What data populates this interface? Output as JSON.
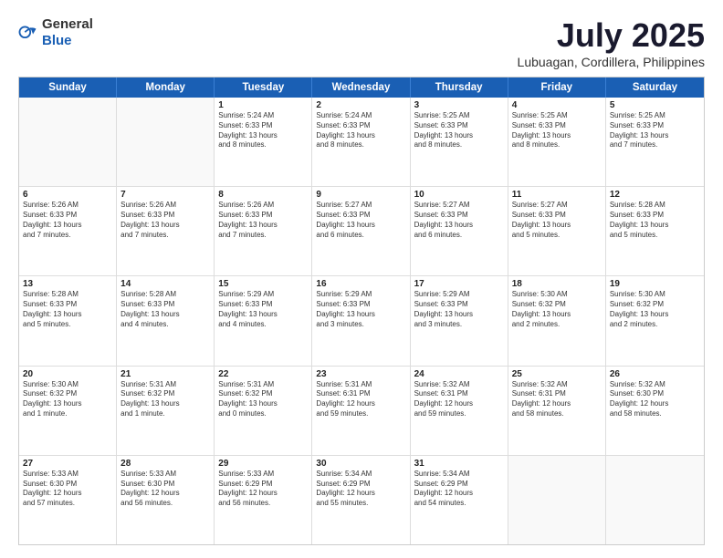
{
  "header": {
    "logo_general": "General",
    "logo_blue": "Blue",
    "month": "July 2025",
    "location": "Lubuagan, Cordillera, Philippines"
  },
  "weekdays": [
    "Sunday",
    "Monday",
    "Tuesday",
    "Wednesday",
    "Thursday",
    "Friday",
    "Saturday"
  ],
  "rows": [
    [
      {
        "day": "",
        "text": "",
        "empty": true
      },
      {
        "day": "",
        "text": "",
        "empty": true
      },
      {
        "day": "1",
        "text": "Sunrise: 5:24 AM\nSunset: 6:33 PM\nDaylight: 13 hours\nand 8 minutes."
      },
      {
        "day": "2",
        "text": "Sunrise: 5:24 AM\nSunset: 6:33 PM\nDaylight: 13 hours\nand 8 minutes."
      },
      {
        "day": "3",
        "text": "Sunrise: 5:25 AM\nSunset: 6:33 PM\nDaylight: 13 hours\nand 8 minutes."
      },
      {
        "day": "4",
        "text": "Sunrise: 5:25 AM\nSunset: 6:33 PM\nDaylight: 13 hours\nand 8 minutes."
      },
      {
        "day": "5",
        "text": "Sunrise: 5:25 AM\nSunset: 6:33 PM\nDaylight: 13 hours\nand 7 minutes."
      }
    ],
    [
      {
        "day": "6",
        "text": "Sunrise: 5:26 AM\nSunset: 6:33 PM\nDaylight: 13 hours\nand 7 minutes."
      },
      {
        "day": "7",
        "text": "Sunrise: 5:26 AM\nSunset: 6:33 PM\nDaylight: 13 hours\nand 7 minutes."
      },
      {
        "day": "8",
        "text": "Sunrise: 5:26 AM\nSunset: 6:33 PM\nDaylight: 13 hours\nand 7 minutes."
      },
      {
        "day": "9",
        "text": "Sunrise: 5:27 AM\nSunset: 6:33 PM\nDaylight: 13 hours\nand 6 minutes."
      },
      {
        "day": "10",
        "text": "Sunrise: 5:27 AM\nSunset: 6:33 PM\nDaylight: 13 hours\nand 6 minutes."
      },
      {
        "day": "11",
        "text": "Sunrise: 5:27 AM\nSunset: 6:33 PM\nDaylight: 13 hours\nand 5 minutes."
      },
      {
        "day": "12",
        "text": "Sunrise: 5:28 AM\nSunset: 6:33 PM\nDaylight: 13 hours\nand 5 minutes."
      }
    ],
    [
      {
        "day": "13",
        "text": "Sunrise: 5:28 AM\nSunset: 6:33 PM\nDaylight: 13 hours\nand 5 minutes."
      },
      {
        "day": "14",
        "text": "Sunrise: 5:28 AM\nSunset: 6:33 PM\nDaylight: 13 hours\nand 4 minutes."
      },
      {
        "day": "15",
        "text": "Sunrise: 5:29 AM\nSunset: 6:33 PM\nDaylight: 13 hours\nand 4 minutes."
      },
      {
        "day": "16",
        "text": "Sunrise: 5:29 AM\nSunset: 6:33 PM\nDaylight: 13 hours\nand 3 minutes."
      },
      {
        "day": "17",
        "text": "Sunrise: 5:29 AM\nSunset: 6:33 PM\nDaylight: 13 hours\nand 3 minutes."
      },
      {
        "day": "18",
        "text": "Sunrise: 5:30 AM\nSunset: 6:32 PM\nDaylight: 13 hours\nand 2 minutes."
      },
      {
        "day": "19",
        "text": "Sunrise: 5:30 AM\nSunset: 6:32 PM\nDaylight: 13 hours\nand 2 minutes."
      }
    ],
    [
      {
        "day": "20",
        "text": "Sunrise: 5:30 AM\nSunset: 6:32 PM\nDaylight: 13 hours\nand 1 minute."
      },
      {
        "day": "21",
        "text": "Sunrise: 5:31 AM\nSunset: 6:32 PM\nDaylight: 13 hours\nand 1 minute."
      },
      {
        "day": "22",
        "text": "Sunrise: 5:31 AM\nSunset: 6:32 PM\nDaylight: 13 hours\nand 0 minutes."
      },
      {
        "day": "23",
        "text": "Sunrise: 5:31 AM\nSunset: 6:31 PM\nDaylight: 12 hours\nand 59 minutes."
      },
      {
        "day": "24",
        "text": "Sunrise: 5:32 AM\nSunset: 6:31 PM\nDaylight: 12 hours\nand 59 minutes."
      },
      {
        "day": "25",
        "text": "Sunrise: 5:32 AM\nSunset: 6:31 PM\nDaylight: 12 hours\nand 58 minutes."
      },
      {
        "day": "26",
        "text": "Sunrise: 5:32 AM\nSunset: 6:30 PM\nDaylight: 12 hours\nand 58 minutes."
      }
    ],
    [
      {
        "day": "27",
        "text": "Sunrise: 5:33 AM\nSunset: 6:30 PM\nDaylight: 12 hours\nand 57 minutes."
      },
      {
        "day": "28",
        "text": "Sunrise: 5:33 AM\nSunset: 6:30 PM\nDaylight: 12 hours\nand 56 minutes."
      },
      {
        "day": "29",
        "text": "Sunrise: 5:33 AM\nSunset: 6:29 PM\nDaylight: 12 hours\nand 56 minutes."
      },
      {
        "day": "30",
        "text": "Sunrise: 5:34 AM\nSunset: 6:29 PM\nDaylight: 12 hours\nand 55 minutes."
      },
      {
        "day": "31",
        "text": "Sunrise: 5:34 AM\nSunset: 6:29 PM\nDaylight: 12 hours\nand 54 minutes."
      },
      {
        "day": "",
        "text": "",
        "empty": true
      },
      {
        "day": "",
        "text": "",
        "empty": true
      }
    ]
  ]
}
